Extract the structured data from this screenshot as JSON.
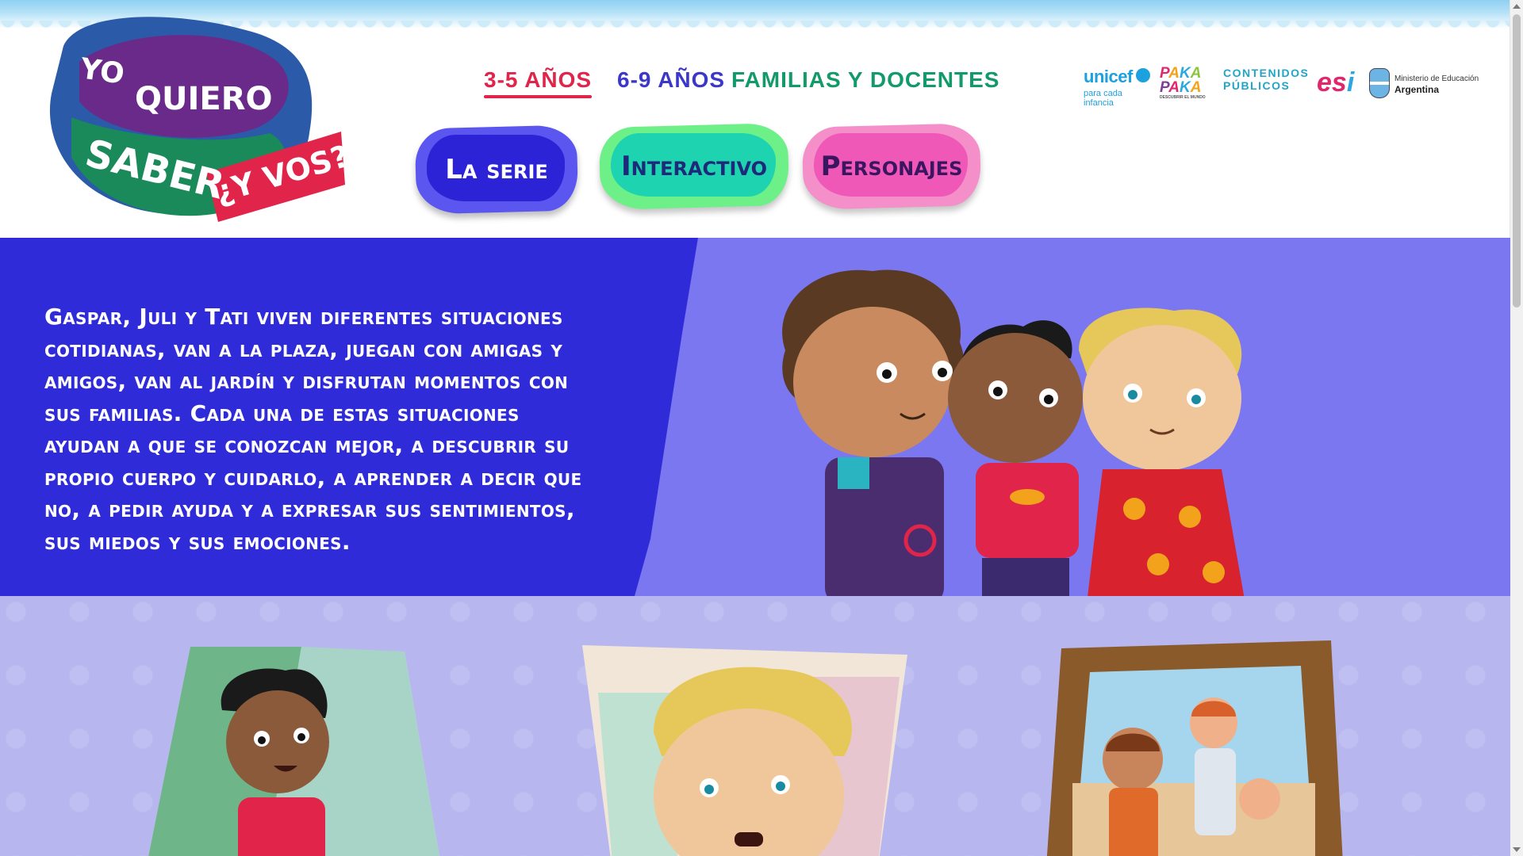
{
  "brand": {
    "logo_lines": [
      "YO",
      "QUIERO",
      "SABER",
      "¿Y VOS?"
    ]
  },
  "nav": {
    "age_3_5": "3-5 AÑOS",
    "age_6_9": "6-9 AÑOS",
    "families": "FAMILIAS Y DOCENTES"
  },
  "partners": {
    "unicef": "unicef",
    "unicef_sub": "para cada infancia",
    "pakapaka_row1": [
      "P",
      "A",
      "K",
      "A"
    ],
    "pakapaka_row2": [
      "P",
      "A",
      "K",
      "A"
    ],
    "pakapaka_sub": "DESCUBRIR EL MUNDO",
    "contenidos_1": "CONTENIDOS",
    "contenidos_2": "PÚBLICOS",
    "esi_e": "es",
    "esi_i": "i",
    "ministerio_1": "Ministerio de Educación",
    "ministerio_2": "Argentina"
  },
  "buttons": {
    "serie": "La serie",
    "interactivo": "Interactivo",
    "personajes": "Personajes"
  },
  "hero": {
    "text": "Gaspar, Juli y Tati viven diferentes situaciones cotidianas, van a la plaza, juegan con amigas y amigos, van al jardín y disfrutan momentos con sus familias. Cada una de estas situaciones ayudan a que se conozcan mejor, a descubrir su propio cuerpo y cuidarlo, a aprender a decir que no, a pedir ayuda y a expresar sus sentimientos, sus miedos y sus emociones."
  },
  "colors": {
    "accent_red": "#e0244a",
    "nav_blue": "#3a37c9",
    "nav_green": "#139a6a",
    "hero_blue": "#2f2bd9",
    "hero_light": "#7b77f0",
    "gallery_bg": "#b7b6ef"
  },
  "icons": {
    "kids_illustration": "three-kids-illustration",
    "card1": "gaspar-lying-on-grass-image",
    "card2": "juli-worried-image",
    "card3": "family-photo-frame-image"
  }
}
